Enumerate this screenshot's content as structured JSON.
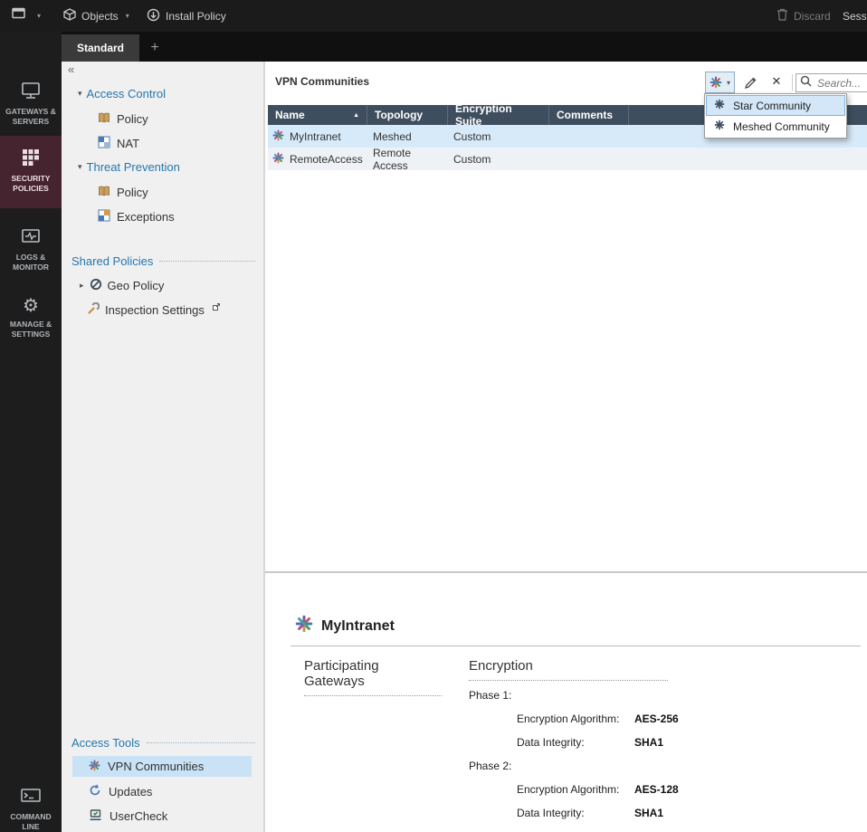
{
  "topbar": {
    "objects": "Objects",
    "install_policy": "Install Policy",
    "discard": "Discard",
    "session": "Sessi"
  },
  "tabbar": {
    "active_tab": "Standard",
    "new_tab": "+"
  },
  "sidebar": {
    "gateways": "GATEWAYS & SERVERS",
    "security": "SECURITY POLICIES",
    "logs": "LOGS & MONITOR",
    "manage": "MANAGE & SETTINGS",
    "command": "COMMAND LINE"
  },
  "nav": {
    "collapse": "«",
    "access_control": "Access Control",
    "access_policy": "Policy",
    "access_nat": "NAT",
    "threat_prevention": "Threat Prevention",
    "threat_policy": "Policy",
    "threat_exceptions": "Exceptions",
    "shared_policies": "Shared Policies",
    "geo_policy": "Geo Policy",
    "inspection_settings": "Inspection Settings",
    "access_tools": "Access Tools",
    "vpn_communities": "VPN Communities",
    "updates": "Updates",
    "usercheck": "UserCheck"
  },
  "content": {
    "title": "VPN Communities",
    "search_placeholder": "Search...",
    "sort_arrow": "▲",
    "columns": {
      "name": "Name",
      "topology": "Topology",
      "suite": "Encryption Suite",
      "comments": "Comments"
    },
    "rows": [
      {
        "name": "MyIntranet",
        "topology": "Meshed",
        "suite": "Custom",
        "comments": ""
      },
      {
        "name": "RemoteAccess",
        "topology": "Remote Access",
        "suite": "Custom",
        "comments": ""
      }
    ],
    "new_menu": {
      "star": "Star Community",
      "meshed": "Meshed Community"
    }
  },
  "details": {
    "title": "MyIntranet",
    "gateways_header": "Participating Gateways",
    "encryption_header": "Encryption",
    "phase1": "Phase 1:",
    "phase2": "Phase 2:",
    "enc_alg": "Encryption Algorithm:",
    "data_int": "Data Integrity:",
    "phase1_alg": "AES-256",
    "phase1_int": "SHA1",
    "phase2_alg": "AES-128",
    "phase2_int": "SHA1"
  },
  "colors": {
    "accent_blue": "#2577ae",
    "table_header": "#3f4e5f",
    "selected_row": "#d7eaf9",
    "active_nav": "#45232f"
  }
}
